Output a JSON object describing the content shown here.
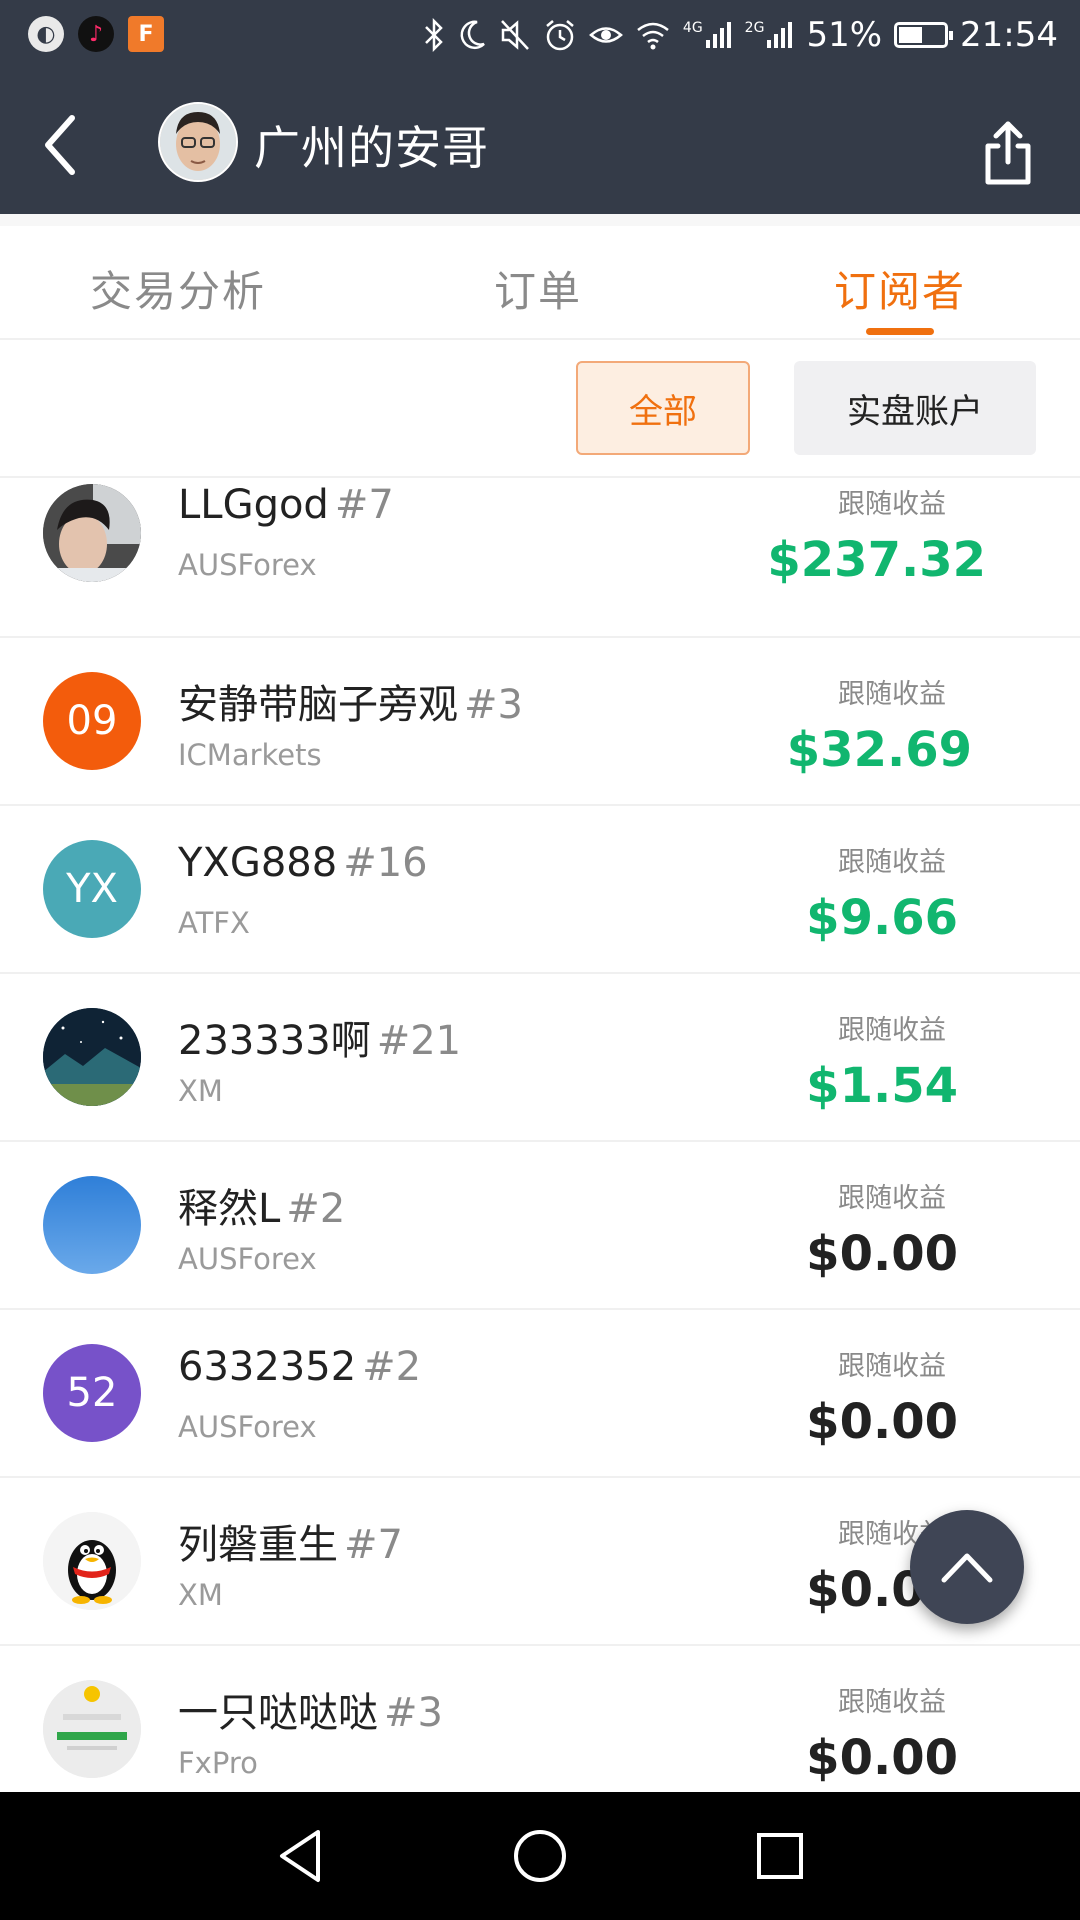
{
  "status_bar": {
    "time": "21:54",
    "battery_percent": "51%",
    "battery_level": 0.51,
    "network_4g": "4G",
    "network_2g": "2G"
  },
  "header": {
    "title": "广州的安哥"
  },
  "tabs": [
    {
      "label": "交易分析",
      "active": false
    },
    {
      "label": "订单",
      "active": false
    },
    {
      "label": "订阅者",
      "active": true
    }
  ],
  "filters": {
    "all_label": "全部",
    "real_label": "实盘账户",
    "selected": "全部"
  },
  "subscribers": [
    {
      "name": "LLGgod",
      "rank": "#7",
      "broker": "AUSForex",
      "profit_label": "跟随收益",
      "profit": "$237.32",
      "avatar_text": "",
      "avatar_color": "#6d6d6d"
    },
    {
      "name": "安静带脑子旁观",
      "rank": "#3",
      "broker": "ICMarkets",
      "profit_label": "跟随收益",
      "profit": "$32.69",
      "avatar_text": "09",
      "avatar_color": "#f35c0c"
    },
    {
      "name": "YXG888",
      "rank": "#16",
      "broker": "ATFX",
      "profit_label": "跟随收益",
      "profit": "$9.66",
      "avatar_text": "YX",
      "avatar_color": "#4aa9b6"
    },
    {
      "name": "233333啊",
      "rank": "#21",
      "broker": "XM",
      "profit_label": "跟随收益",
      "profit": "$1.54",
      "avatar_text": "",
      "avatar_color": "#1d3a52"
    },
    {
      "name": "释然L",
      "rank": "#2",
      "broker": "AUSForex",
      "profit_label": "跟随收益",
      "profit": "$0.00",
      "avatar_text": "",
      "avatar_color": "#3f8fd9"
    },
    {
      "name": "6332352",
      "rank": "#2",
      "broker": "AUSForex",
      "profit_label": "跟随收益",
      "profit": "$0.00",
      "avatar_text": "52",
      "avatar_color": "#7752c9"
    },
    {
      "name": "列磐重生",
      "rank": "#7",
      "broker": "XM",
      "profit_label": "跟随收益",
      "profit": "$0.00",
      "avatar_text": "",
      "avatar_color": "#ffffff"
    },
    {
      "name": "一只哒哒哒",
      "rank": "#3",
      "broker": "FxPro",
      "profit_label": "跟随收益",
      "profit": "$0.00",
      "avatar_text": "",
      "avatar_color": "#ececec"
    }
  ],
  "colors": {
    "accent": "#f0700f",
    "header_bg": "#343b48",
    "profit_positive": "#11b66f",
    "profit_zero": "#222222"
  }
}
